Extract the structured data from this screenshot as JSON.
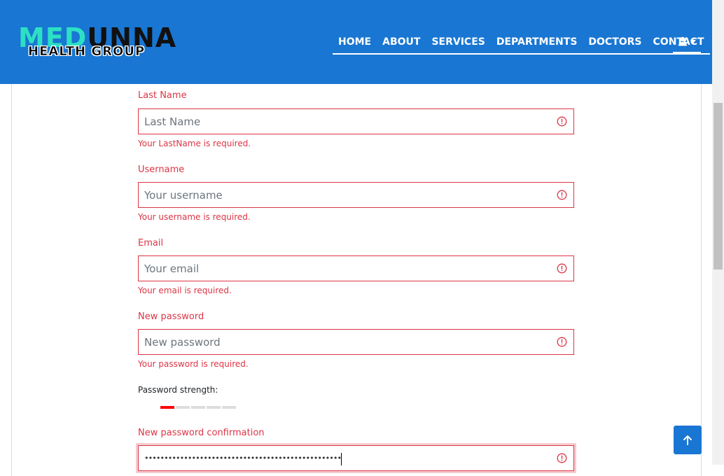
{
  "header": {
    "logo_part1": "MED",
    "logo_part2": "UNNA",
    "logo_bottom": "HEALTH GROUP",
    "nav": [
      "HOME",
      "ABOUT",
      "SERVICES",
      "DEPARTMENTS",
      "DOCTORS",
      "CONTACT"
    ],
    "user_icon": "user-icon",
    "dropdown_icon": "caret-down-icon",
    "bg_color": "#1976d2"
  },
  "form": {
    "last_name": {
      "label": "Last Name",
      "placeholder": "Last Name",
      "error": "Your LastName is required."
    },
    "username": {
      "label": "Username",
      "placeholder": "Your username",
      "error": "Your username is required."
    },
    "email": {
      "label": "Email",
      "placeholder": "Your email",
      "error": "Your email is required."
    },
    "new_password": {
      "label": "New password",
      "placeholder": "New password",
      "error": "Your password is required."
    },
    "strength": {
      "label": "Password strength:",
      "level": 1,
      "segments": 5,
      "active_color": "#ff0000"
    },
    "confirm_password": {
      "label": "New password confirmation",
      "value": "••••••••••••••••••••••••••••••••••••••••••••••••••••••••"
    },
    "error_color": "#dc3545"
  },
  "scroll_top_icon": "arrow-up-icon"
}
